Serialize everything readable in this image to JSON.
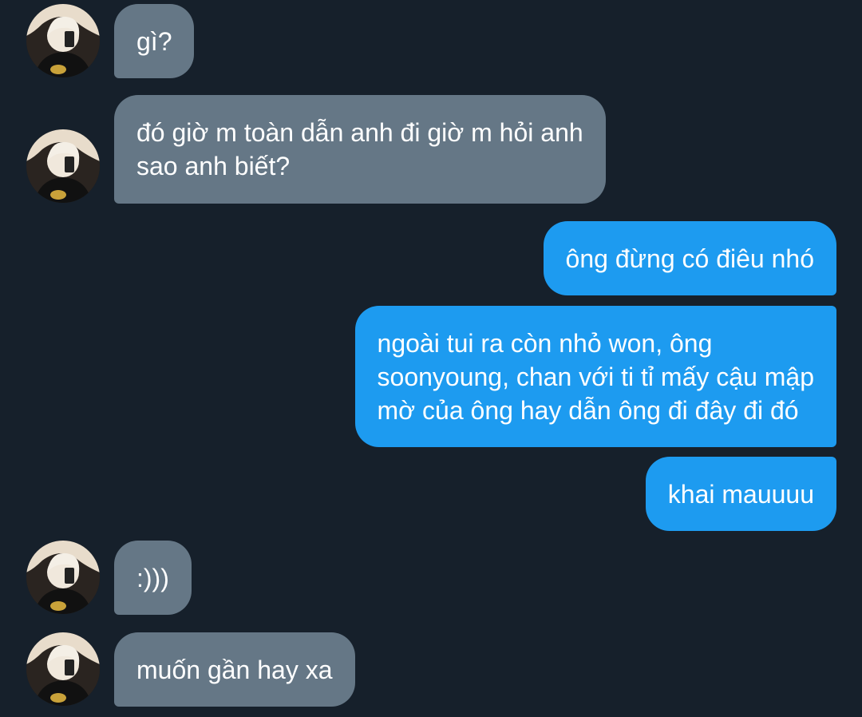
{
  "messages": [
    {
      "sender": "them",
      "text": "gì?"
    },
    {
      "sender": "them",
      "text": "đó giờ m toàn dẫn anh đi giờ m hỏi anh\nsao anh biết?"
    },
    {
      "sender": "me",
      "text": "ông đừng có điêu nhó"
    },
    {
      "sender": "me",
      "text": "ngoài tui ra còn nhỏ won, ông\nsoonyoung, chan với ti tỉ mấy cậu mập\nmờ của ông hay dẫn ông đi đây đi đó"
    },
    {
      "sender": "me",
      "text": "khai mauuuu"
    },
    {
      "sender": "them",
      "text": ":)))"
    },
    {
      "sender": "them",
      "text": "muốn gần hay xa"
    }
  ],
  "colors": {
    "background": "#16202b",
    "incoming_bubble": "#657786",
    "outgoing_bubble": "#1d9bf0",
    "text": "#ffffff"
  },
  "icons": {
    "avatar": "user-avatar-photo"
  }
}
